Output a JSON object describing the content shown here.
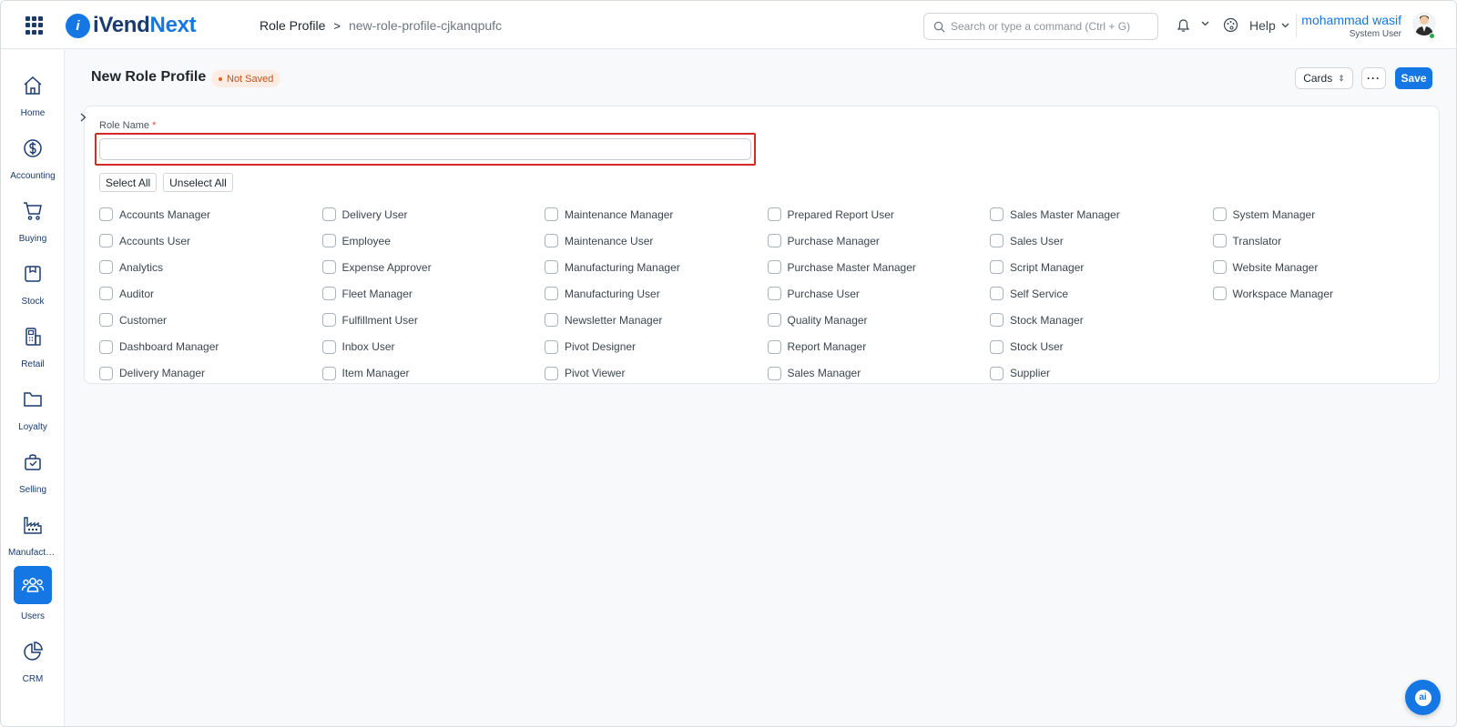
{
  "app": {
    "logo_mark": "i",
    "logo_part1": "iVend",
    "logo_part2": "Next",
    "brand_color": "#1577e4"
  },
  "breadcrumb": {
    "parent": "Role Profile",
    "separator": ">",
    "current": "new-role-profile-cjkanqpufc"
  },
  "search": {
    "placeholder": "Search or type a command (Ctrl + G)",
    "value": ""
  },
  "header": {
    "help_label": "Help",
    "user_name": "mohammad wasif",
    "user_role": "System User"
  },
  "sidebar": {
    "items": [
      {
        "label": "Home",
        "icon": "home-icon"
      },
      {
        "label": "Accounting",
        "icon": "dollar-icon"
      },
      {
        "label": "Buying",
        "icon": "cart-icon"
      },
      {
        "label": "Stock",
        "icon": "box-icon"
      },
      {
        "label": "Retail",
        "icon": "pos-terminal-icon"
      },
      {
        "label": "Loyalty",
        "icon": "folder-icon"
      },
      {
        "label": "Selling",
        "icon": "shopping-bag-icon"
      },
      {
        "label": "Manufacturing",
        "icon": "factory-icon"
      },
      {
        "label": "Users",
        "icon": "users-icon",
        "active": true
      },
      {
        "label": "CRM",
        "icon": "pie-chart-icon"
      }
    ]
  },
  "page": {
    "title": "New Role Profile",
    "status_badge": "Not Saved",
    "view_select": "Cards",
    "more_label": "···",
    "save_label": "Save"
  },
  "form": {
    "role_name_label": "Role Name",
    "required_mark": "*",
    "role_name_value": "",
    "select_all_label": "Select All",
    "unselect_all_label": "Unselect All",
    "roles": [
      "Accounts Manager",
      "Accounts User",
      "Analytics",
      "Auditor",
      "Customer",
      "Dashboard Manager",
      "Delivery Manager",
      "Delivery User",
      "Employee",
      "Expense Approver",
      "Fleet Manager",
      "Fulfillment User",
      "Inbox User",
      "Item Manager",
      "Maintenance Manager",
      "Maintenance User",
      "Manufacturing Manager",
      "Manufacturing User",
      "Newsletter Manager",
      "Pivot Designer",
      "Pivot Viewer",
      "Prepared Report User",
      "Purchase Manager",
      "Purchase Master Manager",
      "Purchase User",
      "Quality Manager",
      "Report Manager",
      "Sales Manager",
      "Sales Master Manager",
      "Sales User",
      "Script Manager",
      "Self Service",
      "Stock Manager",
      "Stock User",
      "Supplier",
      "System Manager",
      "Translator",
      "Website Manager",
      "Workspace Manager"
    ]
  },
  "ai_button": {
    "label": "ai"
  }
}
